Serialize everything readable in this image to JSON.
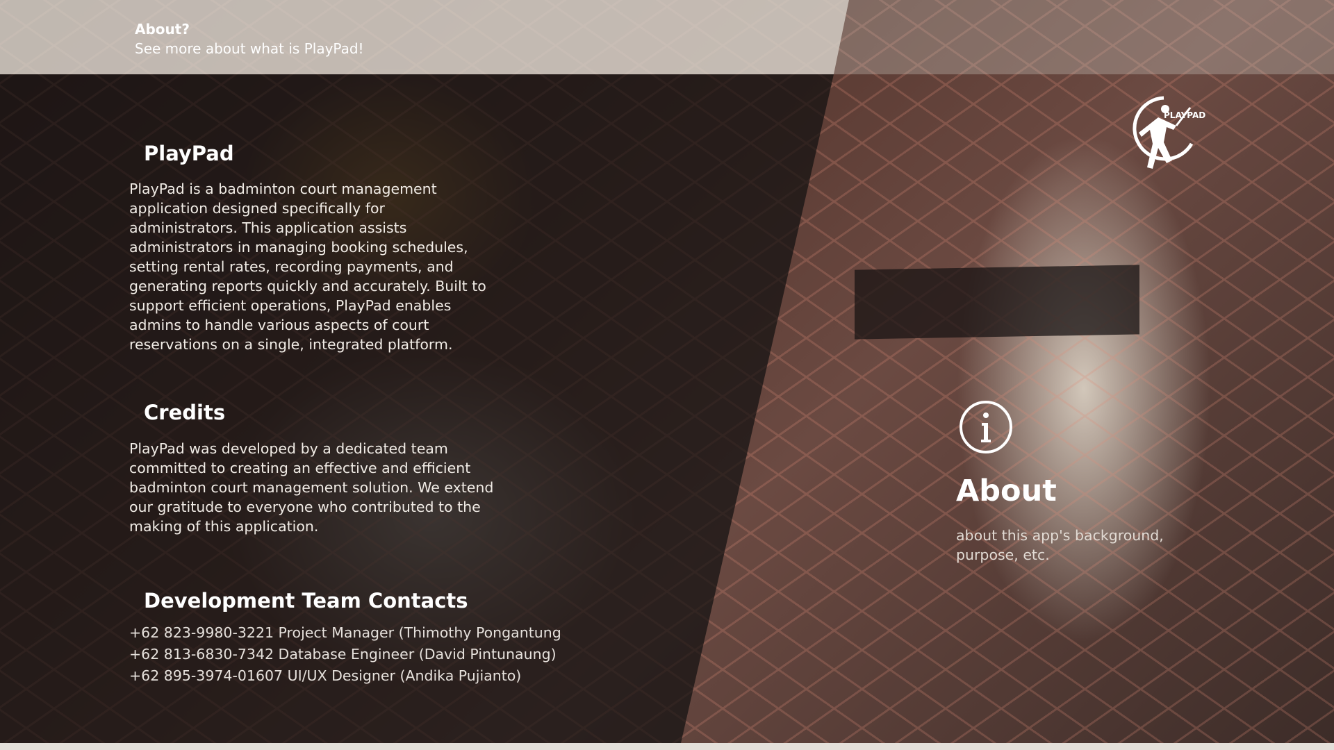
{
  "header": {
    "title": "About?",
    "subtitle": "See more about what is PlayPad!"
  },
  "sections": {
    "playpad": {
      "title": "PlayPad",
      "body": "PlayPad is a badminton court management application designed specifically for administrators. This application assists administrators in managing booking schedules, setting rental rates, recording payments, and generating reports quickly and accurately. Built to support efficient operations, PlayPad enables admins to handle various aspects of court reservations on a single, integrated platform."
    },
    "credits": {
      "title": "Credits",
      "body": "PlayPad was developed by a dedicated team committed to creating an effective and efficient badminton court management solution. We extend our gratitude to everyone who contributed to the making of this application."
    },
    "contacts": {
      "title": "Development Team Contacts",
      "items": [
        "+62 823-9980-3221 Project Manager (Thimothy Pongantung",
        "+62 813-6830-7342 Database Engineer (David Pintunaung)",
        "+62 895-3974-01607 UI/UX Designer (Andika Pujianto)"
      ]
    }
  },
  "about": {
    "icon": "info-icon",
    "title": "About",
    "description": "about this app's background, purpose, etc."
  },
  "logo": {
    "text": "PLAYPAD",
    "icon": "badminton-player-logo"
  },
  "colors": {
    "header_overlay": "#d6d0c8",
    "dark_panel": "#121010",
    "text_primary": "#ffffff"
  }
}
